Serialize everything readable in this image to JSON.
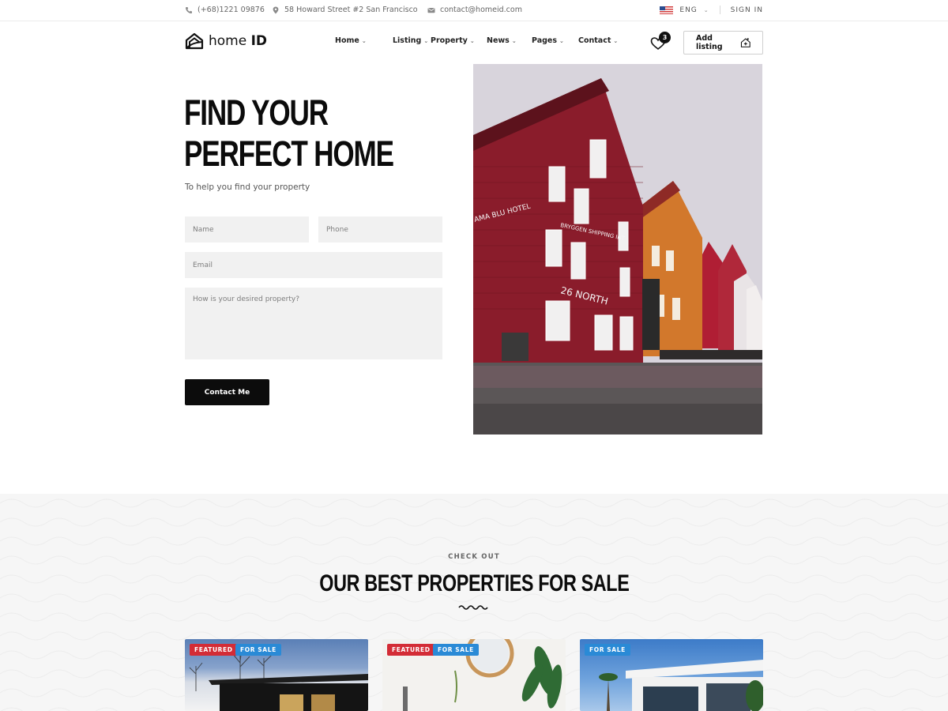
{
  "topbar": {
    "phone": "(+68)1221 09876",
    "address": "58 Howard Street #2 San Francisco",
    "email": "contact@homeid.com",
    "language": "ENG",
    "sign_in": "SIGN IN"
  },
  "nav": {
    "logo_light": "home",
    "logo_bold": "ID",
    "menu": [
      "Home",
      "Listing",
      "Property",
      "News",
      "Pages",
      "Contact"
    ],
    "wishlist_count": "3",
    "add_listing": "Add listing"
  },
  "hero": {
    "title_line1": "FIND YOUR",
    "title_line2": "PERFECT HOME",
    "subtitle": "To help you find your property",
    "form": {
      "name_placeholder": "Name",
      "phone_placeholder": "Phone",
      "email_placeholder": "Email",
      "message_placeholder": "How is your desired property?",
      "submit": "Contact Me"
    },
    "photo_signs": {
      "hotel": "AMA BLU HOTEL",
      "shipping": "BRYGGEN SHIPPING INT",
      "number": "26 NORTH"
    }
  },
  "section": {
    "kicker": "CHECK OUT",
    "title": "OUR BEST PROPERTIES FOR SALE"
  },
  "cards": [
    {
      "tags": [
        "FEATURED",
        "FOR SALE"
      ]
    },
    {
      "tags": [
        "FEATURED",
        "FOR SALE"
      ]
    },
    {
      "tags": [
        "FOR SALE"
      ]
    }
  ],
  "colors": {
    "primary": "#0c0c0c",
    "featured_tag": "#d32c36",
    "sale_tag": "#2a8ad6",
    "input_bg": "#f1f1f1"
  }
}
